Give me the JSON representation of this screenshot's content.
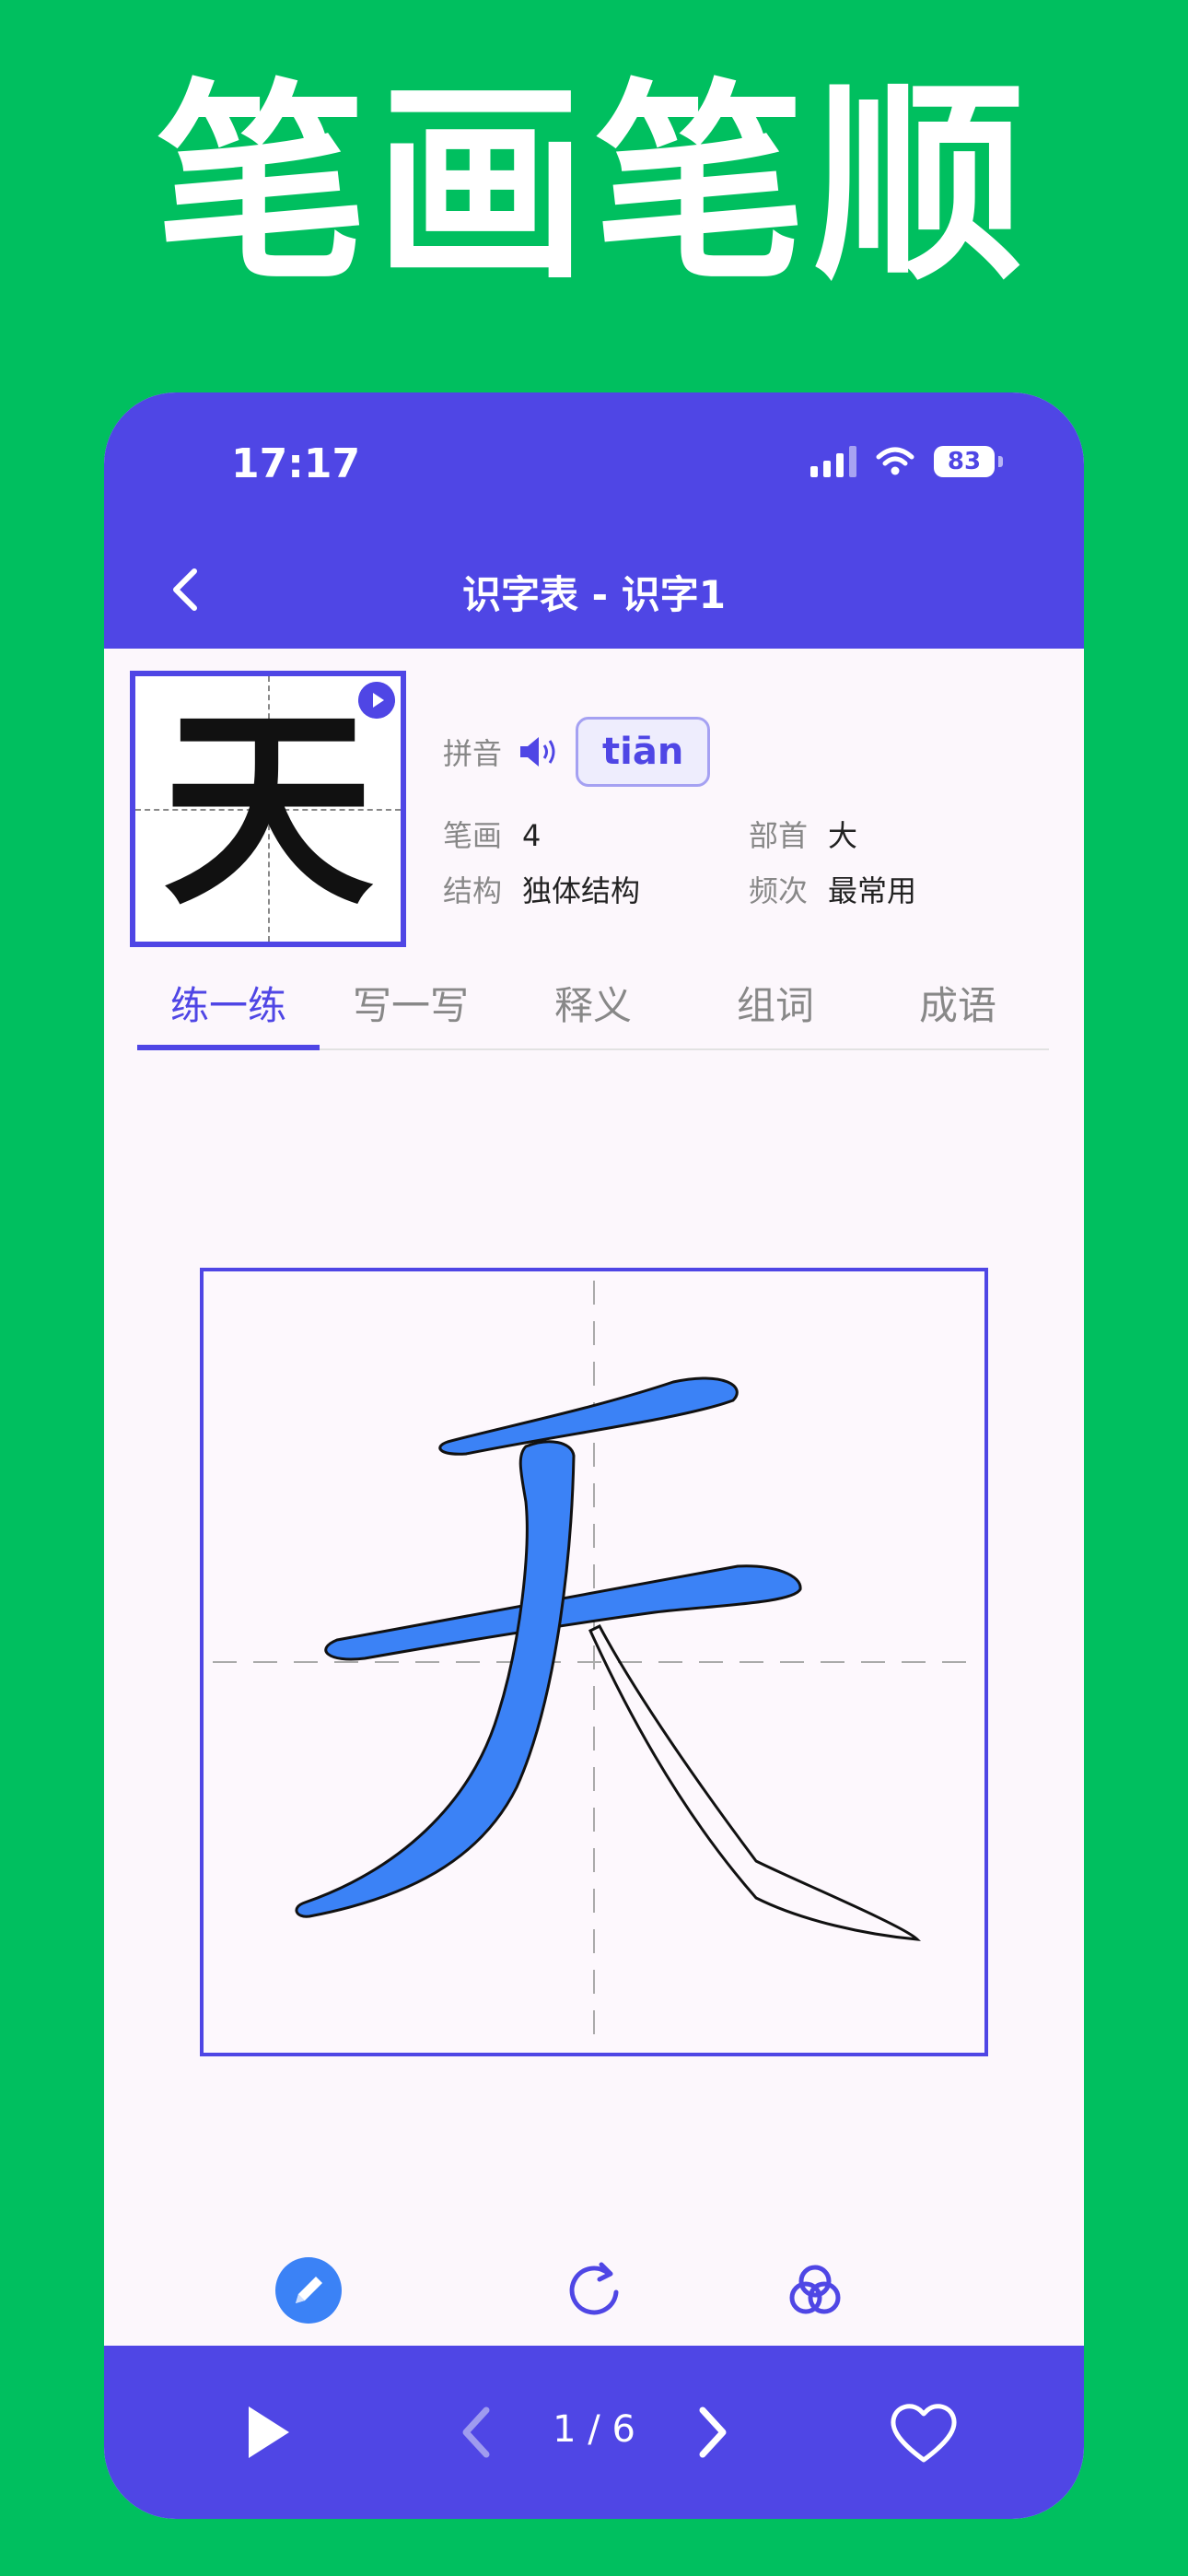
{
  "promo": {
    "title": "笔画笔顺"
  },
  "status_bar": {
    "time": "17:17",
    "battery": "83"
  },
  "nav": {
    "title": "识字表 - 识字1"
  },
  "character": {
    "glyph": "天",
    "pinyin_label": "拼音",
    "pinyin": "tiān",
    "strokes_label": "笔画",
    "strokes": "4",
    "radical_label": "部首",
    "radical": "大",
    "structure_label": "结构",
    "structure": "独体结构",
    "frequency_label": "频次",
    "frequency": "最常用"
  },
  "tabs": [
    {
      "label": "练一练",
      "active": true
    },
    {
      "label": "写一写",
      "active": false
    },
    {
      "label": "释义",
      "active": false
    },
    {
      "label": "组词",
      "active": false
    },
    {
      "label": "成语",
      "active": false
    }
  ],
  "canvas": {
    "completed_strokes": 3,
    "total_strokes": 4,
    "stroke_color": "#3B82F6"
  },
  "pager": {
    "indicator": "1 / 6"
  },
  "colors": {
    "accent": "#4F46E5",
    "background": "#00BF5F",
    "tool_blue": "#3B82F6"
  }
}
